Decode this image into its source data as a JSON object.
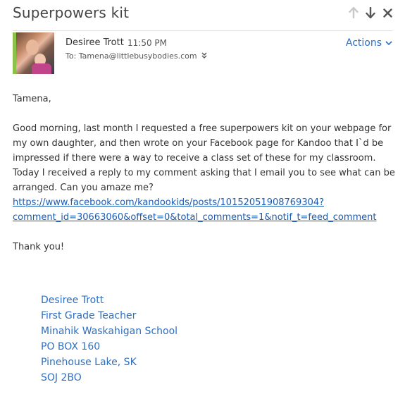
{
  "email": {
    "subject": "Superpowers kit",
    "sender_name": "Desiree Trott",
    "time": "11:50 PM",
    "to": "To: Tamena@littlebusybodies.com",
    "actions_label": "Actions",
    "greeting": "Tamena,",
    "body_text": "Good morning, last month I requested a free superpowers kit on your webpage for my own daughter, and then wrote on your Facebook page for Kandoo that I`d be impressed if there were a way to receive a class set of these for my classroom. Today I received a reply to my comment asking that I email you to see what can be arranged. Can you amaze me? ",
    "link_text": "https://www.facebook.com/kandookids/posts/10152051908769304?comment_id=30663060&offset=0&total_comments=1&notif_t=feed_comment",
    "closing": "Thank you!",
    "signature": [
      "Desiree Trott",
      "First Grade Teacher",
      "Minahik Waskahigan School",
      "PO BOX 160",
      "Pinehouse Lake, SK",
      "SOJ 2BO"
    ]
  },
  "icons": {
    "up": "arrow-up-icon",
    "down": "arrow-down-icon",
    "close": "close-icon",
    "actions_chevron": "chevron-down-icon",
    "expand_to": "double-chevron-down-icon"
  },
  "colors": {
    "link": "#1a5cb5",
    "actions": "#2a70c8",
    "signature": "#2f6fc0",
    "avatar_border": "#8bc34a"
  }
}
